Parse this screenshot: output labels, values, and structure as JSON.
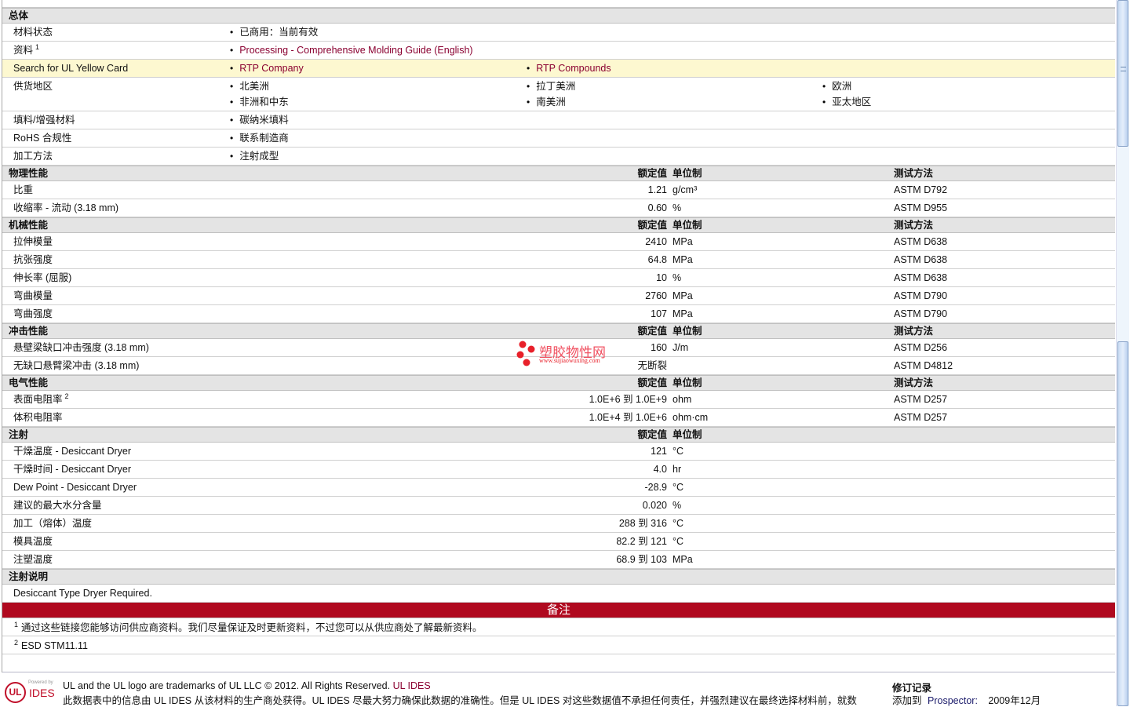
{
  "general": {
    "title": "总体",
    "rows": [
      {
        "label": "材料状态",
        "values": [
          [
            "已商用：当前有效"
          ]
        ],
        "link": false
      },
      {
        "label": "资料",
        "sup": "1",
        "values": [
          [
            "Processing - Comprehensive Molding Guide (English)"
          ]
        ],
        "link": true
      },
      {
        "label": "Search for UL Yellow Card",
        "values": [
          [
            "RTP Company"
          ],
          [
            "RTP Compounds"
          ]
        ],
        "link": true,
        "yellow": true
      },
      {
        "label": "供货地区",
        "values": [
          [
            "北美洲",
            "非洲和中东"
          ],
          [
            "拉丁美洲",
            "南美洲"
          ],
          [
            "欧洲",
            "亚太地区"
          ]
        ],
        "link": false
      },
      {
        "label": "填料/增强材料",
        "values": [
          [
            "碳纳米填料"
          ]
        ],
        "link": false
      },
      {
        "label": "RoHS 合规性",
        "values": [
          [
            "联系制造商"
          ]
        ],
        "link": false
      },
      {
        "label": "加工方法",
        "values": [
          [
            "注射成型"
          ]
        ],
        "link": false
      }
    ]
  },
  "sections": [
    {
      "title": "物理性能",
      "h_value": "额定值",
      "h_unit": "单位制",
      "h_method": "测试方法",
      "rows": [
        {
          "label": "比重",
          "value": "1.21",
          "unit": "g/cm³",
          "method": "ASTM D792"
        },
        {
          "label": "收缩率  - 流动  (3.18 mm)",
          "value": "0.60",
          "unit": "%",
          "method": "ASTM D955"
        }
      ]
    },
    {
      "title": "机械性能",
      "h_value": "额定值",
      "h_unit": "单位制",
      "h_method": "测试方法",
      "rows": [
        {
          "label": "拉伸模量",
          "value": "2410",
          "unit": "MPa",
          "method": "ASTM D638"
        },
        {
          "label": "抗张强度",
          "value": "64.8",
          "unit": "MPa",
          "method": "ASTM D638"
        },
        {
          "label": "伸长率  (屈服)",
          "value": "10",
          "unit": "%",
          "method": "ASTM D638"
        },
        {
          "label": "弯曲模量",
          "value": "2760",
          "unit": "MPa",
          "method": "ASTM D790"
        },
        {
          "label": "弯曲强度",
          "value": "107",
          "unit": "MPa",
          "method": "ASTM D790"
        }
      ]
    },
    {
      "title": "冲击性能",
      "h_value": "额定值",
      "h_unit": "单位制",
      "h_method": "测试方法",
      "rows": [
        {
          "label": "悬壁梁缺口冲击强度  (3.18 mm)",
          "value": "160",
          "unit": "J/m",
          "method": "ASTM D256"
        },
        {
          "label": "无缺口悬臂梁冲击  (3.18 mm)",
          "value": "无断裂",
          "unit": "",
          "method": "ASTM D4812"
        }
      ]
    },
    {
      "title": "电气性能",
      "h_value": "额定值",
      "h_unit": "单位制",
      "h_method": "测试方法",
      "rows": [
        {
          "label": "表面电阻率",
          "sup": "2",
          "value": "1.0E+6 到  1.0E+9",
          "unit": "ohm",
          "method": "ASTM D257"
        },
        {
          "label": "体积电阻率",
          "value": "1.0E+4 到  1.0E+6",
          "unit": "ohm·cm",
          "method": "ASTM D257"
        }
      ]
    },
    {
      "title": "注射",
      "h_value": "额定值",
      "h_unit": "单位制",
      "rows": [
        {
          "label": "干燥温度  - Desiccant Dryer",
          "value": "121",
          "unit": "°C"
        },
        {
          "label": "干燥时间  - Desiccant Dryer",
          "value": "4.0",
          "unit": "hr"
        },
        {
          "label": "Dew Point - Desiccant Dryer",
          "value": "-28.9",
          "unit": "°C"
        },
        {
          "label": "建议的最大水分含量",
          "value": "0.020",
          "unit": "%"
        },
        {
          "label": "加工（熔体）温度",
          "value": "288 到  316",
          "unit": "°C"
        },
        {
          "label": "模具温度",
          "value": "82.2 到  121",
          "unit": "°C"
        },
        {
          "label": "注塑温度",
          "value": "68.9 到  103",
          "unit": "MPa"
        }
      ]
    }
  ],
  "injection_notes": {
    "title": "注射说明",
    "text": "Desiccant Type Dryer Required."
  },
  "notes": {
    "title": "备注",
    "footnotes": [
      {
        "n": "1",
        "text": "通过这些链接您能够访问供应商资料。我们尽量保证及时更新资料，不过您可以从供应商处了解最新资料。"
      },
      {
        "n": "2",
        "text": "ESD STM11.11"
      }
    ]
  },
  "watermark": {
    "name": "塑胶物性网",
    "url": "www.sujiaowuxing.com"
  },
  "footer": {
    "powered": "Powered by",
    "ides": "IDES",
    "logo": "UL",
    "line1": "UL and the UL logo are trademarks of UL LLC © 2012. All Rights Reserved.",
    "line1_link": "UL IDES",
    "line2": "此数据表中的信息由  UL IDES 从该材料的生产商处获得。UL IDES 尽最大努力确保此数据的准确性。但是  UL IDES 对这些数据值不承担任何责任，并强烈建议在最终选择材料前，就数",
    "revision_title": "修订记录",
    "added_label": "添加到",
    "added_link": "Prospector:",
    "added_date": "2009年12月"
  },
  "colors": {
    "accent": "#b0091f",
    "link": "#8a0030",
    "highlight": "#fdf8d0"
  }
}
